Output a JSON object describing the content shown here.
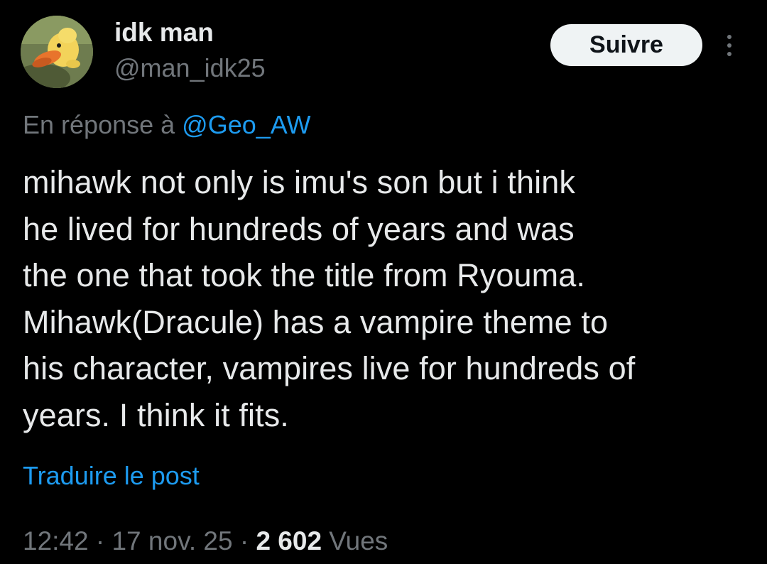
{
  "author": {
    "display_name": "idk man",
    "handle": "@man_idk25",
    "avatar": "cartoon-duck-avatar"
  },
  "actions": {
    "follow_label": "Suivre",
    "more_icon": "more-vertical-icon"
  },
  "reply": {
    "prefix": "En réponse à ",
    "mention": "@Geo_AW"
  },
  "tweet": {
    "lines": [
      "mihawk not only is imu's son but i think",
      "he lived for hundreds of years and was",
      "the one that took the title from Ryouma.",
      "Mihawk(Dracule) has a vampire theme to",
      "his character, vampires live for hundreds of",
      "years. I think it fits."
    ]
  },
  "translate_label": "Traduire le post",
  "meta": {
    "time": "12:42",
    "separator": " · ",
    "date": "17 nov. 25",
    "views_count": "2 602",
    "views_label": " Vues"
  },
  "colors": {
    "background": "#000000",
    "text_primary": "#e7e9ea",
    "text_secondary": "#71767b",
    "link": "#1d9bf0",
    "button_bg": "#eff3f4"
  }
}
